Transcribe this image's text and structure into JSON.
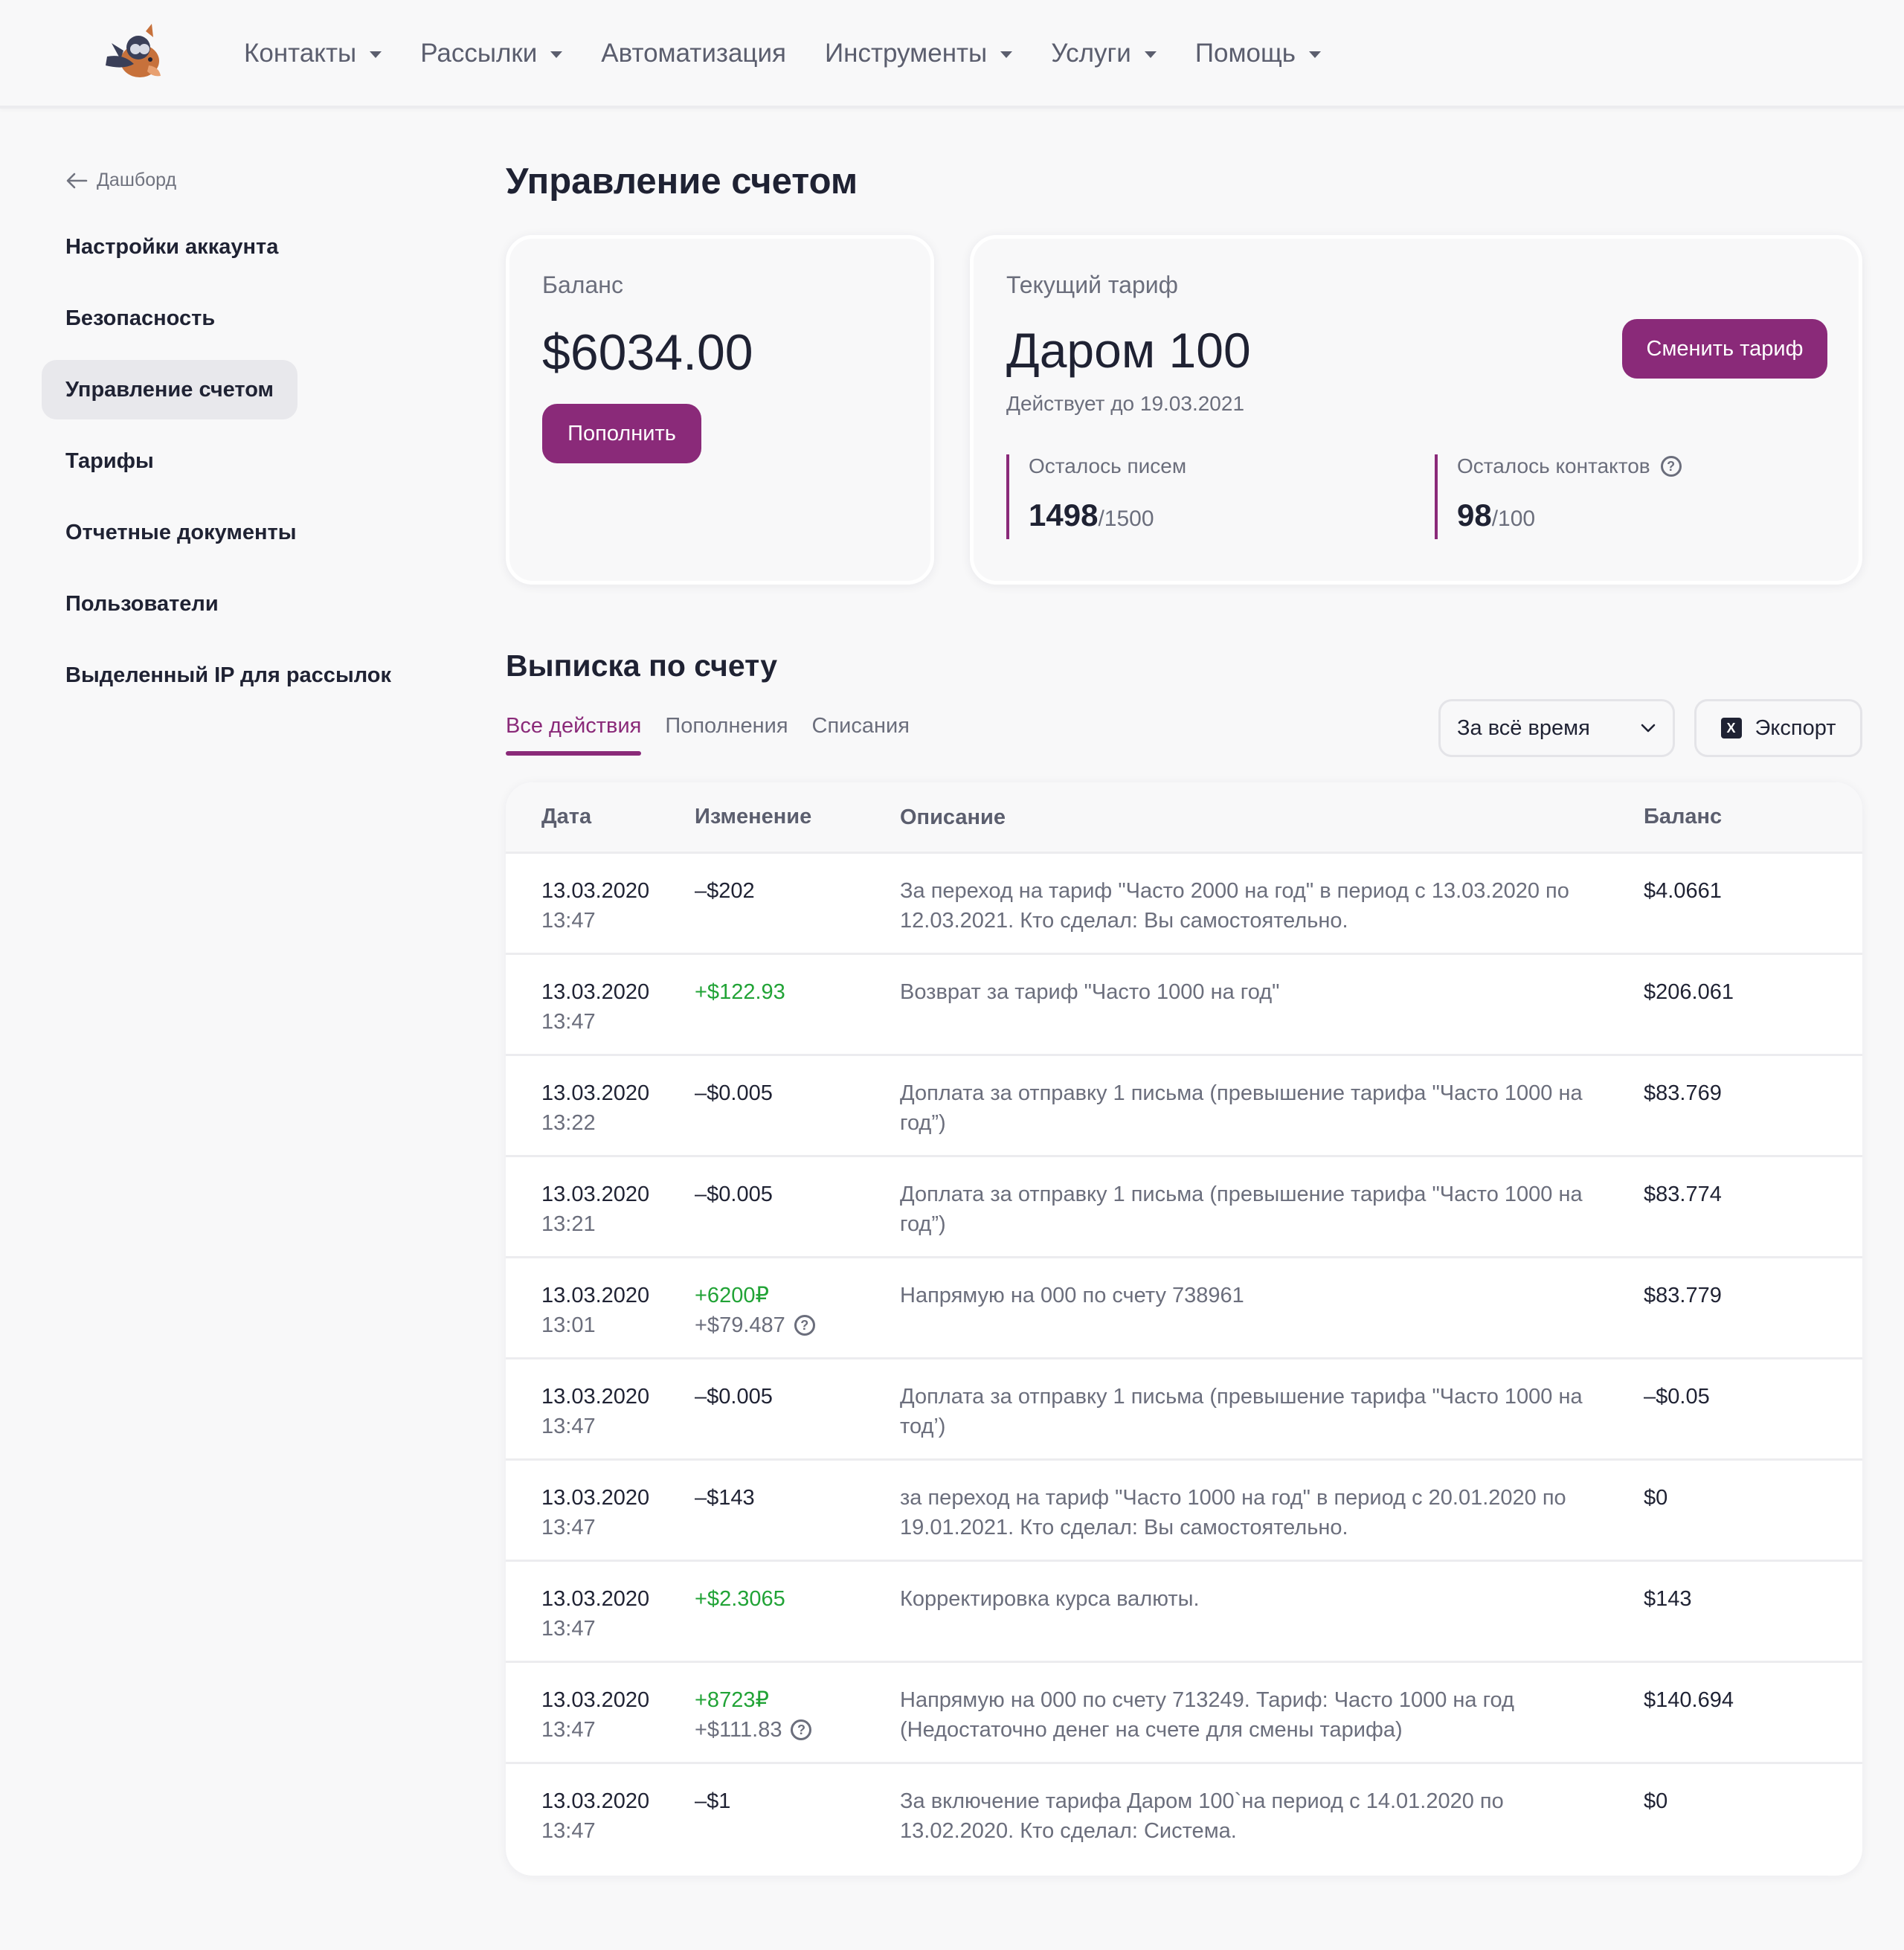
{
  "nav": {
    "items": [
      {
        "label": "Контакты",
        "caret": true
      },
      {
        "label": "Рассылки",
        "caret": true
      },
      {
        "label": "Автоматизация",
        "caret": false
      },
      {
        "label": "Инструменты",
        "caret": true
      },
      {
        "label": "Услуги",
        "caret": true
      },
      {
        "label": "Помощь",
        "caret": true
      }
    ]
  },
  "sidebar": {
    "back_label": "Дашборд",
    "items": [
      {
        "label": "Настройки аккаунта"
      },
      {
        "label": "Безопасность"
      },
      {
        "label": "Управление счетом",
        "active": true
      },
      {
        "label": "Тарифы"
      },
      {
        "label": "Отчетные документы"
      },
      {
        "label": "Пользователи"
      },
      {
        "label": "Выделенный IP для рассылок"
      }
    ]
  },
  "page_title": "Управление счетом",
  "balance": {
    "label": "Баланс",
    "value": "$6034.00",
    "topup_label": "Пополнить"
  },
  "tariff": {
    "label": "Текущий тариф",
    "name": "Даром 100",
    "valid_until": "Действует до 19.03.2021",
    "change_label": "Сменить тариф",
    "letters_label": "Осталось писем",
    "letters_value": "1498",
    "letters_total": "/1500",
    "contacts_label": "Осталось контактов",
    "contacts_value": "98",
    "contacts_total": "/100"
  },
  "statement": {
    "title": "Выписка по счету",
    "tabs": [
      "Все действия",
      "Пополнения",
      "Списания"
    ],
    "period": "За всё время",
    "export_label": "Экспорт",
    "columns": [
      "Дата",
      "Изменение",
      "Описание",
      "Баланс"
    ],
    "rows": [
      {
        "date": "13.03.2020",
        "time": "13:47",
        "change": "–$202",
        "sign": "neg",
        "desc": "За переход на тариф \"Часто 2000 на год\" в период с 13.03.2020 по 12.03.2021. Кто сделал: Вы самостоятельно.",
        "balance": "$4.0661"
      },
      {
        "date": "13.03.2020",
        "time": "13:47",
        "change": "+$122.93",
        "sign": "pos",
        "desc": "Возврат за тариф \"Часто 1000 на год\"",
        "balance": "$206.061"
      },
      {
        "date": "13.03.2020",
        "time": "13:22",
        "change": "–$0.005",
        "sign": "neg",
        "desc": "Доплата за отправку 1 письма (превышение тарифа \"Часто 1000 на год”)",
        "balance": "$83.769"
      },
      {
        "date": "13.03.2020",
        "time": "13:21",
        "change": "–$0.005",
        "sign": "neg",
        "desc": "Доплата за отправку 1 письма (превышение тарифа \"Часто 1000 на год”)",
        "balance": "$83.774"
      },
      {
        "date": "13.03.2020",
        "time": "13:01",
        "change": "+6200₽",
        "sign": "pos",
        "sub": "+$79.487",
        "desc": "Напрямую на 000 по счету 738961",
        "balance": "$83.779"
      },
      {
        "date": "13.03.2020",
        "time": "13:47",
        "change": "–$0.005",
        "sign": "neg",
        "desc": "Доплата за отправку 1 письма (превышение тарифа \"Часто 1000 на тод’)",
        "balance": "–$0.05"
      },
      {
        "date": "13.03.2020",
        "time": "13:47",
        "change": "–$143",
        "sign": "neg",
        "desc": "за переход на тариф \"Часто 1000 на год\" в период с 20.01.2020 по 19.01.2021. Кто сделал: Вы самостоятельно.",
        "balance": "$0"
      },
      {
        "date": "13.03.2020",
        "time": "13:47",
        "change": "+$2.3065",
        "sign": "pos",
        "desc": "Корректировка курса валюты.",
        "balance": "$143"
      },
      {
        "date": "13.03.2020",
        "time": "13:47",
        "change": "+8723₽",
        "sign": "pos",
        "sub": "+$111.83",
        "desc": "Напрямую на 000 по счету 713249. Тариф: Часто 1000 на год (Недостаточно денег на счете для смены тарифа)",
        "balance": "$140.694"
      },
      {
        "date": "13.03.2020",
        "time": "13:47",
        "change": "–$1",
        "sign": "neg",
        "desc": "За включение тарифа Даром 100`на период с 14.01.2020 по 13.02.2020. Кто сделал: Система.",
        "balance": "$0"
      }
    ]
  },
  "colors": {
    "accent": "#8a2a79",
    "positive": "#21a336",
    "text": "#1f2233",
    "muted": "#6b6e7c"
  }
}
